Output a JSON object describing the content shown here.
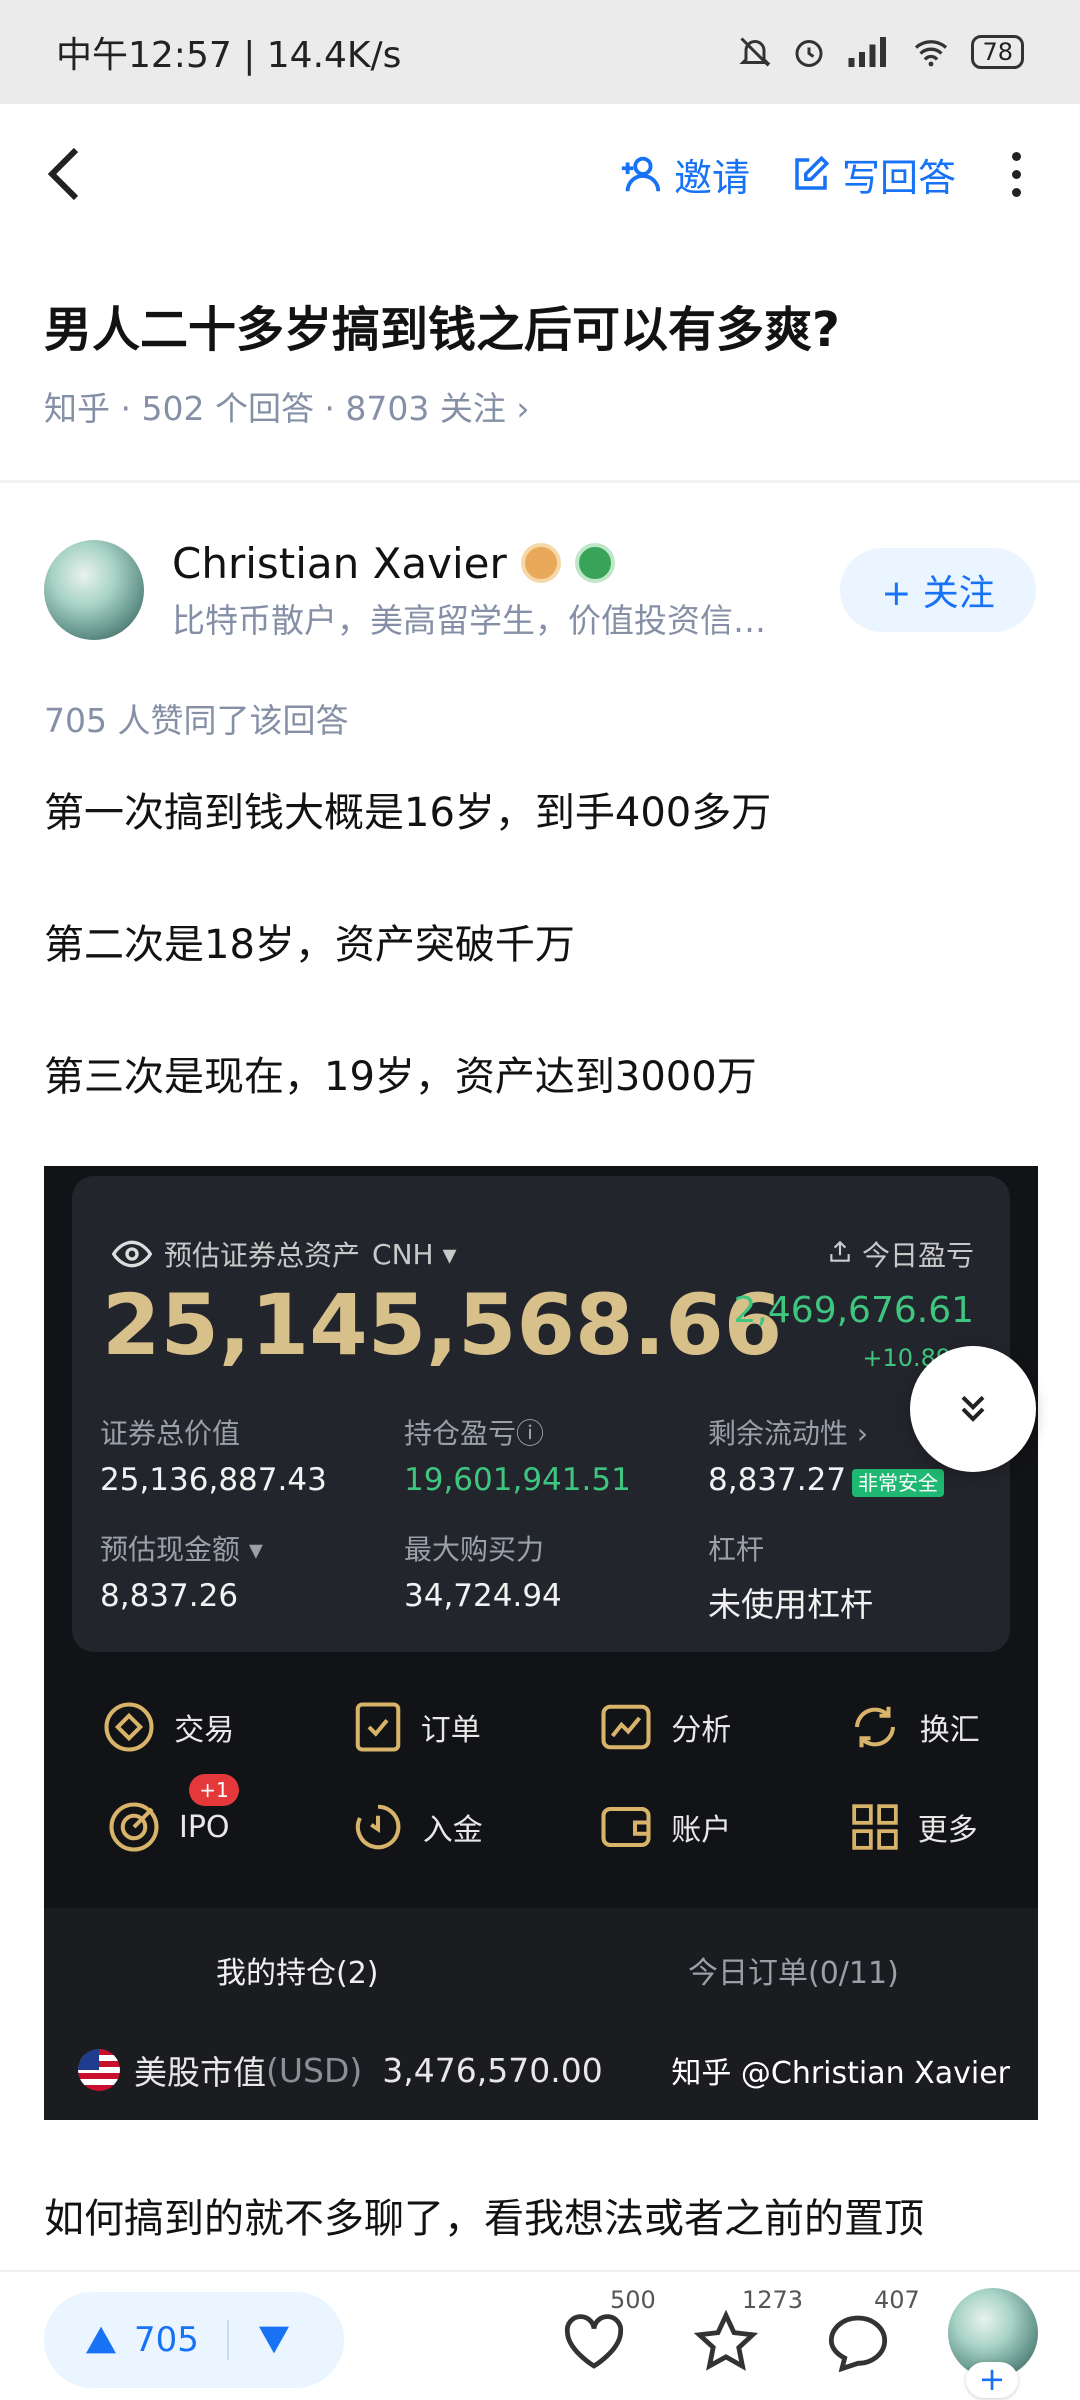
{
  "status_bar": {
    "time_speed": "中午12:57 | 14.4K/s",
    "battery": "78"
  },
  "app_bar": {
    "invite_label": "邀请",
    "write_answer_label": "写回答"
  },
  "question": {
    "title": "男人二十多岁搞到钱之后可以有多爽?",
    "meta": "知乎 · 502 个回答 · 8703 关注 ›"
  },
  "author": {
    "name": "Christian Xavier",
    "description": "比特币散户，美高留学生，价值投资信…",
    "follow_label": "+ 关注"
  },
  "answer": {
    "votes_text": "705 人赞同了该回答",
    "paragraphs": [
      "第一次搞到钱大概是16岁，到手400多万",
      "第二次是18岁，资产突破千万",
      "第三次是现在，19岁，资产达到3000万"
    ],
    "after_image_text": "如何搞到的就不多聊了，看我想法或者之前的置顶"
  },
  "broker_screenshot": {
    "total_label": "预估证券总资产",
    "currency": "CNH ▾",
    "total_value": "25,145,568.66",
    "today_pnl_label": "今日盈亏",
    "today_pnl": "2,469,676.61",
    "today_pnl_pct": "+10.89%",
    "market_value_label": "证券总价值",
    "market_value": "25,136,887.43",
    "position_pnl_label": "持仓盈亏ⓘ",
    "position_pnl": "19,601,941.51",
    "liquidity_label": "剩余流动性 ›",
    "liquidity": "8,837.27",
    "liquidity_badge": "非常安全",
    "cash_label": "预估现金额 ▾",
    "cash": "8,837.26",
    "buying_power_label": "最大购买力",
    "buying_power": "34,724.94",
    "leverage_label": "杠杆",
    "leverage": "未使用杠杆",
    "menu": [
      "交易",
      "订单",
      "分析",
      "换汇",
      "IPO",
      "入金",
      "账户",
      "更多"
    ],
    "ipo_badge": "+1",
    "tab_holdings": "我的持仓(2)",
    "tab_orders": "今日订单(0/11)",
    "us_market_label": "美股市值",
    "us_market_unit": "(USD)",
    "us_market_value": "3,476,570.00",
    "watermark": "知乎 @Christian Xavier"
  },
  "bottom_bar": {
    "upvote_count": "705",
    "like_count": "500",
    "favorite_count": "1273",
    "comment_count": "407",
    "plus": "+"
  },
  "colors": {
    "brand_blue": "#1772f6",
    "gain_green": "#3ec680",
    "gold": "#d8c08a"
  }
}
